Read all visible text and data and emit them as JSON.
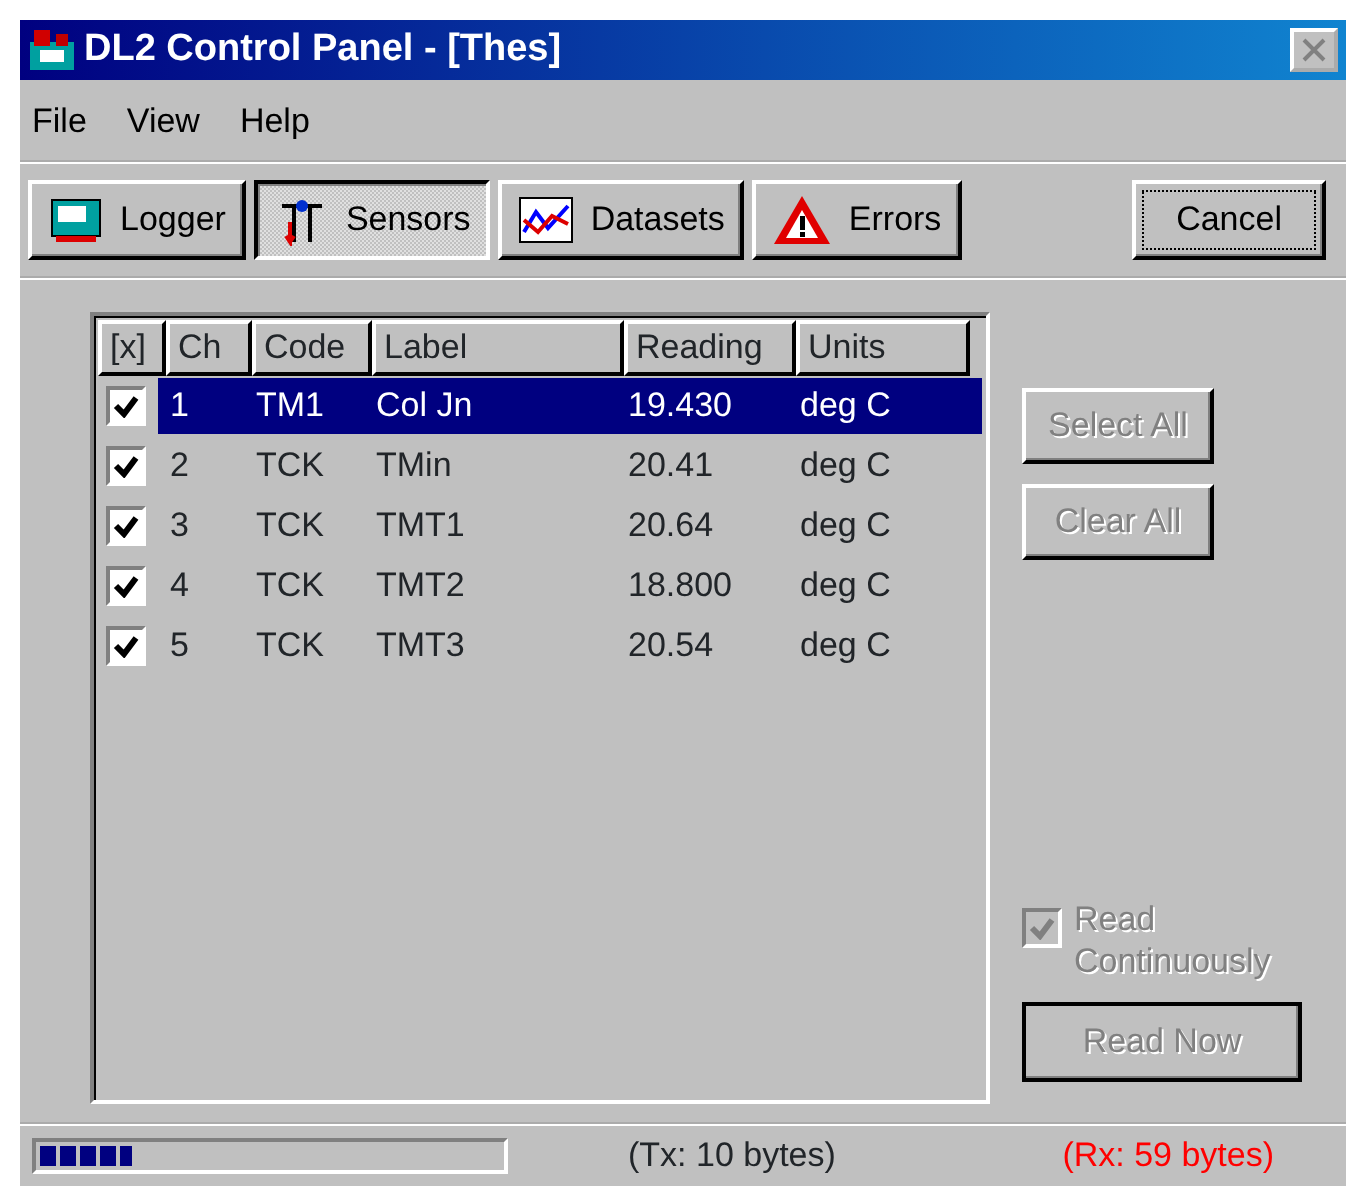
{
  "window": {
    "title": "DL2 Control Panel - [Thes]"
  },
  "menu": [
    "File",
    "View",
    "Help"
  ],
  "tabs": [
    {
      "label": "Logger",
      "selected": false,
      "kind": "logger"
    },
    {
      "label": "Sensors",
      "selected": true,
      "kind": "sensors"
    },
    {
      "label": "Datasets",
      "selected": false,
      "kind": "datasets"
    },
    {
      "label": "Errors",
      "selected": false,
      "kind": "errors"
    }
  ],
  "cancel_button": "Cancel",
  "table": {
    "check_column": "[x]",
    "columns": [
      "Ch",
      "Code",
      "Label",
      "Reading",
      "Units"
    ],
    "rows": [
      {
        "checked": true,
        "selected": true,
        "cells": [
          "1",
          "TM1",
          "Col Jn",
          "19.430",
          "deg C"
        ]
      },
      {
        "checked": true,
        "selected": false,
        "cells": [
          "2",
          "TCK",
          "TMin",
          "20.41",
          "deg C"
        ]
      },
      {
        "checked": true,
        "selected": false,
        "cells": [
          "3",
          "TCK",
          "TMT1",
          "20.64",
          "deg C"
        ]
      },
      {
        "checked": true,
        "selected": false,
        "cells": [
          "4",
          "TCK",
          "TMT2",
          "18.800",
          "deg C"
        ]
      },
      {
        "checked": true,
        "selected": false,
        "cells": [
          "5",
          "TCK",
          "TMT3",
          "20.54",
          "deg C"
        ]
      }
    ]
  },
  "side_buttons": [
    {
      "label": "Select All",
      "disabled": true
    },
    {
      "label": "Clear All",
      "disabled": true
    }
  ],
  "read_continuously": {
    "label": "Read Continuously",
    "checked": true,
    "disabled": true
  },
  "read_now": {
    "label": "Read Now",
    "disabled": true
  },
  "status_bar": {
    "progress": {
      "level": 0.2
    },
    "tx": "(Tx: 10 bytes)",
    "rx": "(Rx: 59 bytes)"
  }
}
